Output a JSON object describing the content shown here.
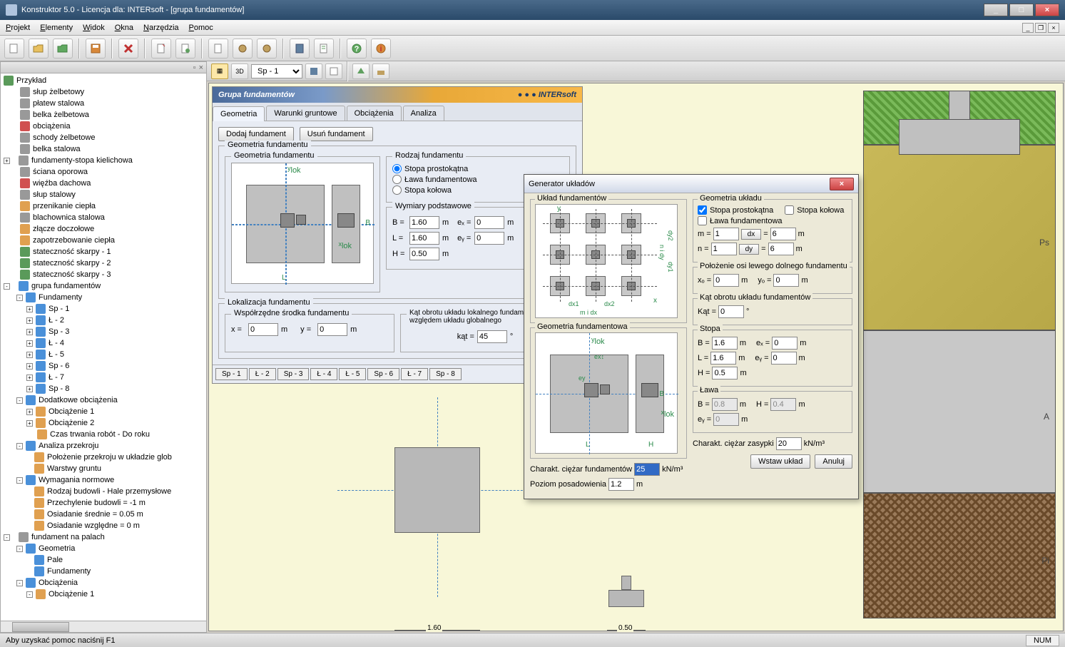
{
  "title": "Konstruktor 5.0 - Licencja dla: INTERsoft - [grupa fundamentów]",
  "menu": {
    "projekt": "Projekt",
    "elementy": "Elementy",
    "widok": "Widok",
    "okna": "Okna",
    "narzedzia": "Narzędzia",
    "pomoc": "Pomoc"
  },
  "contentToolbar": {
    "viewSelect": "Sp - 1",
    "btn3d": "3D"
  },
  "tree": {
    "root": "Przykład",
    "items": [
      "słup żelbetowy",
      "płatew stalowa",
      "belka żelbetowa",
      "obciążenia",
      "schody żelbetowe",
      "belka stalowa",
      "fundamenty-stopa kielichowa",
      "ściana oporowa",
      "więźba dachowa",
      "słup stalowy",
      "przenikanie ciepła",
      "blachownica stalowa",
      "złącze doczołowe",
      "zapotrzebowanie ciepła",
      "stateczność skarpy - 1",
      "stateczność skarpy - 2",
      "stateczność skarpy - 3",
      "grupa fundamentów"
    ],
    "fundamenty": {
      "label": "Fundamenty",
      "items": [
        "Sp - 1",
        "Ł - 2",
        "Sp - 3",
        "Ł - 4",
        "Ł - 5",
        "Sp - 6",
        "Ł - 7",
        "Sp - 8"
      ]
    },
    "dodatkowe": {
      "label": "Dodatkowe obciążenia",
      "items": [
        "Obciążenie 1",
        "Obciążenie 2",
        "Czas trwania robót - Do roku"
      ]
    },
    "analiza": {
      "label": "Analiza przekroju",
      "items": [
        "Położenie przekroju w układzie glob",
        "Warstwy gruntu"
      ]
    },
    "wymagania": {
      "label": "Wymagania normowe",
      "items": [
        "Rodzaj budowli - Hale przemysłowe",
        "Przechylenie budowli = -1 m",
        "Osiadanie średnie = 0.05 m",
        "Osiadanie względne = 0 m"
      ]
    },
    "palach": {
      "label": "fundament na palach",
      "geo": "Geometria",
      "geoItems": [
        "Pale",
        "Fundamenty"
      ],
      "obc": "Obciążenia",
      "obcItems": [
        "Obciążenie 1"
      ]
    }
  },
  "form": {
    "title": "Grupa fundamentów",
    "brand": "INTERsoft",
    "tabs": {
      "geometria": "Geometria",
      "warunki": "Warunki gruntowe",
      "obciazenia": "Obciążenia",
      "analiza": "Analiza"
    },
    "buttons": {
      "dodaj": "Dodaj fundament",
      "usun": "Usuń fundament"
    },
    "sections": {
      "geoFund": "Geometria fundamentu",
      "geoFundInner": "Geometria fundamentu",
      "rodzaj": "Rodzaj fundamentu",
      "wymiary": "Wymiary podstawowe",
      "lokalizacja": "Lokalizacja fundamentu",
      "wspolrzedne": "Współrzędne środka fundamentu",
      "kat": "Kąt obrotu układu lokalnego  fundamentu względem układu globalnego"
    },
    "radio": {
      "stopa": "Stopa prostokątna",
      "lawa": "Ława fundamentowa",
      "kolowa": "Stopa kołowa"
    },
    "values": {
      "B": "1.60",
      "L": "1.60",
      "H": "0.50",
      "ex": "0",
      "ey": "0",
      "x": "0",
      "y": "0",
      "kat": "45"
    },
    "units": {
      "m": "m",
      "deg": "°"
    },
    "labels": {
      "B": "B =",
      "L": "L =",
      "H": "H =",
      "ex": "eₓ =",
      "ey": "eᵧ =",
      "x": "x =",
      "y": "y =",
      "kat": "kąt ="
    },
    "footTabs": [
      "Sp - 1",
      "Ł - 2",
      "Sp - 3",
      "Ł - 4",
      "Ł - 5",
      "Sp - 6",
      "Ł - 7",
      "Sp - 8"
    ]
  },
  "dialog": {
    "title": "Generator układów",
    "sections": {
      "uklad": "Układ fundamentów",
      "geoFund": "Geometria fundamentowa",
      "geoUklad": "Geometria układu",
      "polozenie": "Położenie osi lewego dolnego fundamentu",
      "katObr": "Kąt obrotu układu fundamentów",
      "stopa": "Stopa",
      "lawa": "Ława"
    },
    "checks": {
      "stopaProstokatna": "Stopa prostokątna",
      "stopaKolowa": "Stopa kołowa",
      "lawaFund": "Ława fundamentowa"
    },
    "labels": {
      "m": "m =",
      "n": "n =",
      "dx": "dx",
      "dy": "dy",
      "eq": "=",
      "xo": "xₒ =",
      "yo": "yₒ =",
      "kat": "Kąt =",
      "B": "B =",
      "L": "L =",
      "H": "H =",
      "ex": "eₓ =",
      "ey": "eᵧ =",
      "ciezarFund": "Charakt. ciężar fundamentów",
      "ciezarZas": "Charakt. ciężar zasypki",
      "poziom": "Poziom posadowienia",
      "kN_m3": "kN/m³",
      "mUnit": "m"
    },
    "values": {
      "m": "1",
      "n": "1",
      "dx": "6",
      "dy": "6",
      "xo": "0",
      "yo": "0",
      "kat": "0",
      "stB": "1.6",
      "stL": "1.6",
      "stH": "0.5",
      "stEx": "0",
      "stEy": "0",
      "laB": "0.8",
      "laH": "0.4",
      "laEy": "0",
      "ciezarFund": "25",
      "ciezarZas": "20",
      "poziom": "1.2"
    },
    "buttons": {
      "wstaw": "Wstaw układ",
      "anuluj": "Anuluj"
    }
  },
  "plan": {
    "dim1": "1.60",
    "dim2": "0.50"
  },
  "soil": {
    "ps": "Ps",
    "a": "A",
    "pi": "Pi"
  },
  "status": {
    "help": "Aby uzyskać pomoc naciśnij F1",
    "num": "NUM"
  }
}
